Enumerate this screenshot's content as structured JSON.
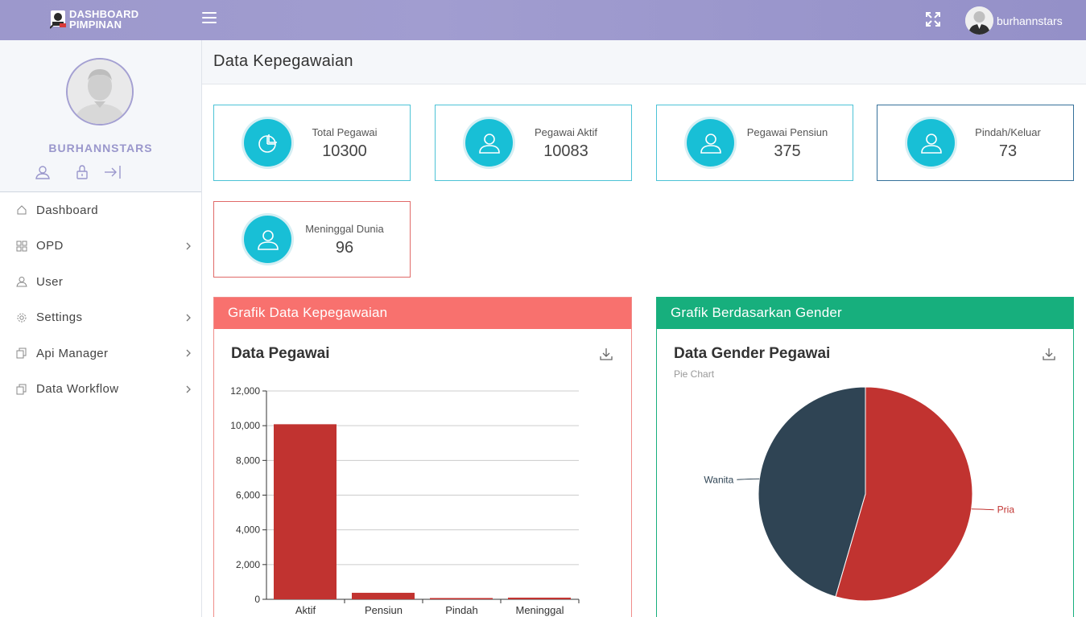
{
  "header": {
    "logo_line1": "DASHBOARD",
    "logo_line2": "PIMPINAN",
    "username": "burhannstars"
  },
  "sidebar": {
    "username": "BURHANNSTARS",
    "items": [
      {
        "label": "Dashboard",
        "icon": "home-icon",
        "has_children": false
      },
      {
        "label": "OPD",
        "icon": "grid-icon",
        "has_children": true
      },
      {
        "label": "User",
        "icon": "user-icon",
        "has_children": false
      },
      {
        "label": "Settings",
        "icon": "gear-icon",
        "has_children": true
      },
      {
        "label": "Api Manager",
        "icon": "copy-icon",
        "has_children": true
      },
      {
        "label": "Data Workflow",
        "icon": "copy-icon",
        "has_children": true
      }
    ]
  },
  "page": {
    "title": "Data Kepegawaian"
  },
  "stats": [
    {
      "label": "Total Pegawai",
      "value": "10300",
      "icon": "pie-icon"
    },
    {
      "label": "Pegawai Aktif",
      "value": "10083",
      "icon": "user-icon"
    },
    {
      "label": "Pegawai Pensiun",
      "value": "375",
      "icon": "user-icon"
    },
    {
      "label": "Pindah/Keluar",
      "value": "73",
      "icon": "user-icon"
    },
    {
      "label": "Meninggal Dunia",
      "value": "96",
      "icon": "user-icon"
    }
  ],
  "panels": {
    "left_header": "Grafik Data Kepegawaian",
    "right_header": "Grafik Berdasarkan Gender",
    "left_color": "#f8716e",
    "right_color": "#17af7d"
  },
  "colors": {
    "bar": "#c13330",
    "pria": "#c13330",
    "wanita": "#2f4454",
    "stat_icon": "#18bfd6"
  },
  "chart_data": [
    {
      "type": "bar",
      "title": "Data Pegawai",
      "categories": [
        "Aktif",
        "Pensiun",
        "Pindah",
        "Meninggal"
      ],
      "values": [
        10083,
        375,
        73,
        96
      ],
      "ylim": [
        0,
        12000
      ],
      "yticks": [
        "0",
        "2,000",
        "4,000",
        "6,000",
        "8,000",
        "10,000",
        "12,000"
      ],
      "grid": true
    },
    {
      "type": "pie",
      "title": "Data Gender Pegawai",
      "subtitle": "Pie Chart",
      "labels": [
        "Pria",
        "Wanita"
      ],
      "values": [
        54.5,
        45.5
      ]
    }
  ]
}
